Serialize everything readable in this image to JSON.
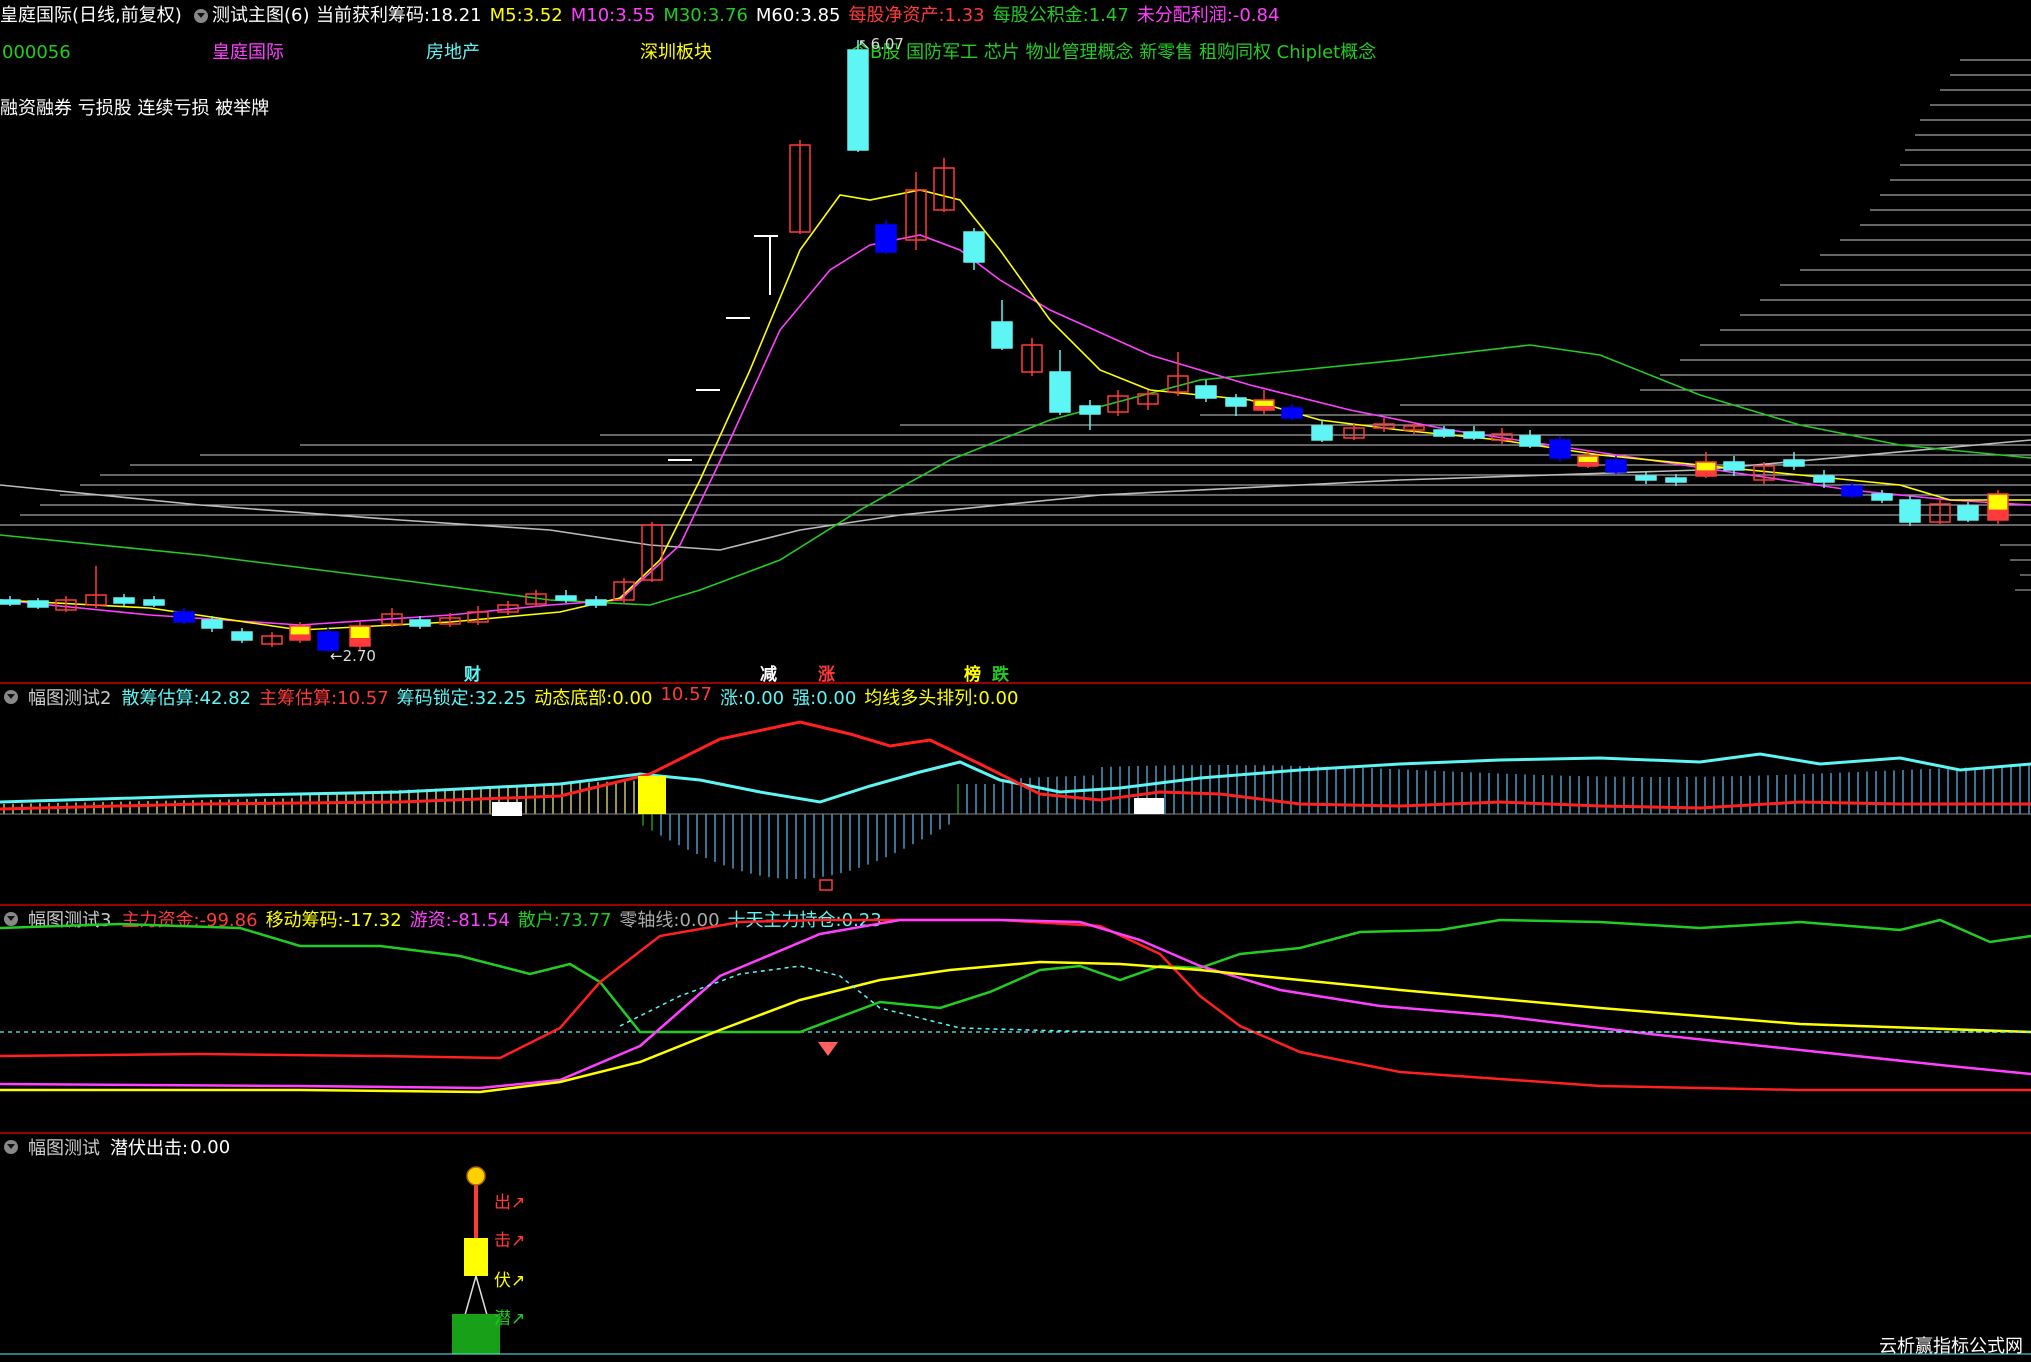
{
  "colors": {
    "bg": "#000000",
    "up": "#ff3a3a",
    "down": "#5ef5f5",
    "blue": "#0000ff",
    "yellow": "#ffff00",
    "magenta": "#ff40ff",
    "green": "#22cc22",
    "white": "#ffffff",
    "grey": "#aaaaaa",
    "separator": "#9a0000"
  },
  "header": {
    "title": "皇庭国际(日线,前复权)",
    "indicator_name": "测试主图(6)",
    "items": [
      {
        "label": "当前获利筹码:",
        "value": "18.21",
        "color": "#ffffff"
      },
      {
        "label": "M5:",
        "value": "3.52",
        "color": "#ffff00"
      },
      {
        "label": "M10:",
        "value": "3.55",
        "color": "#ff40ff"
      },
      {
        "label": "M30:",
        "value": "3.76",
        "color": "#22cc22"
      },
      {
        "label": "M60:",
        "value": "3.85",
        "color": "#ffffff"
      },
      {
        "label": "每股净资产:",
        "value": "1.33",
        "color": "#ff3a3a"
      },
      {
        "label": "每股公积金:",
        "value": "1.47",
        "color": "#22cc22"
      },
      {
        "label": "未分配利润:",
        "value": "-0.84",
        "color": "#ff40ff"
      }
    ]
  },
  "info": {
    "code": "000056",
    "name": "皇庭国际",
    "industry": "房地产",
    "region": "深圳板块",
    "concepts": "含B股 国防军工 芯片 物业管理概念 新零售 租购同权 Chiplet概念",
    "tags": "融资融券 亏损股 连续亏损 被举牌"
  },
  "price_labels": {
    "high": "6.07",
    "low": "2.70"
  },
  "markers": [
    {
      "text": "财",
      "color": "#5ef5f5"
    },
    {
      "text": "减",
      "color": "#ffffff"
    },
    {
      "text": "涨",
      "color": "#ff3a3a"
    },
    {
      "text": "榜",
      "color": "#ffff00"
    },
    {
      "text": "跌",
      "color": "#22cc22"
    }
  ],
  "panel2": {
    "name": "幅图测试2",
    "items": [
      {
        "label": "散筹估算:",
        "value": "42.82",
        "color": "#5ef5f5"
      },
      {
        "label": "主筹估算:",
        "value": "10.57",
        "color": "#ff3a3a"
      },
      {
        "label": "筹码锁定:",
        "value": "32.25",
        "color": "#5ef5f5"
      },
      {
        "label": "动态底部:",
        "value": "0.00",
        "color": "#ffff00"
      },
      {
        "label": "",
        "value": "10.57",
        "color": "#ff3a3a"
      },
      {
        "label": "涨:",
        "value": "0.00",
        "color": "#5ef5f5"
      },
      {
        "label": "强:",
        "value": "0.00",
        "color": "#5ef5f5"
      },
      {
        "label": "均线多头排列:",
        "value": "0.00",
        "color": "#ffff00"
      }
    ]
  },
  "panel3": {
    "name": "幅图测试3",
    "items": [
      {
        "label": "主力资金:",
        "value": "-99.86",
        "color": "#ff3a3a"
      },
      {
        "label": "移动筹码:",
        "value": "-17.32",
        "color": "#ffff00"
      },
      {
        "label": "游资:",
        "value": "-81.54",
        "color": "#ff40ff"
      },
      {
        "label": "散户:",
        "value": "73.77",
        "color": "#22cc22"
      },
      {
        "label": "零轴线:",
        "value": "0.00",
        "color": "#aaaaaa"
      },
      {
        "label": "十天主力持仓:",
        "value": "0.23",
        "color": "#5ef5f5"
      }
    ]
  },
  "panel4": {
    "name": "幅图测试",
    "items": [
      {
        "label": "潜伏出击:",
        "value": "0.00",
        "color": "#ffffff"
      }
    ],
    "signals": [
      {
        "text": "出↗",
        "color": "#ff3a3a"
      },
      {
        "text": "击↗",
        "color": "#ff3a3a"
      },
      {
        "text": "伏↗",
        "color": "#ffff00"
      },
      {
        "text": "潜↗",
        "color": "#22cc22"
      }
    ],
    "coin_icon": "money-bag-icon"
  },
  "watermark": "云析赢指标公式网"
}
